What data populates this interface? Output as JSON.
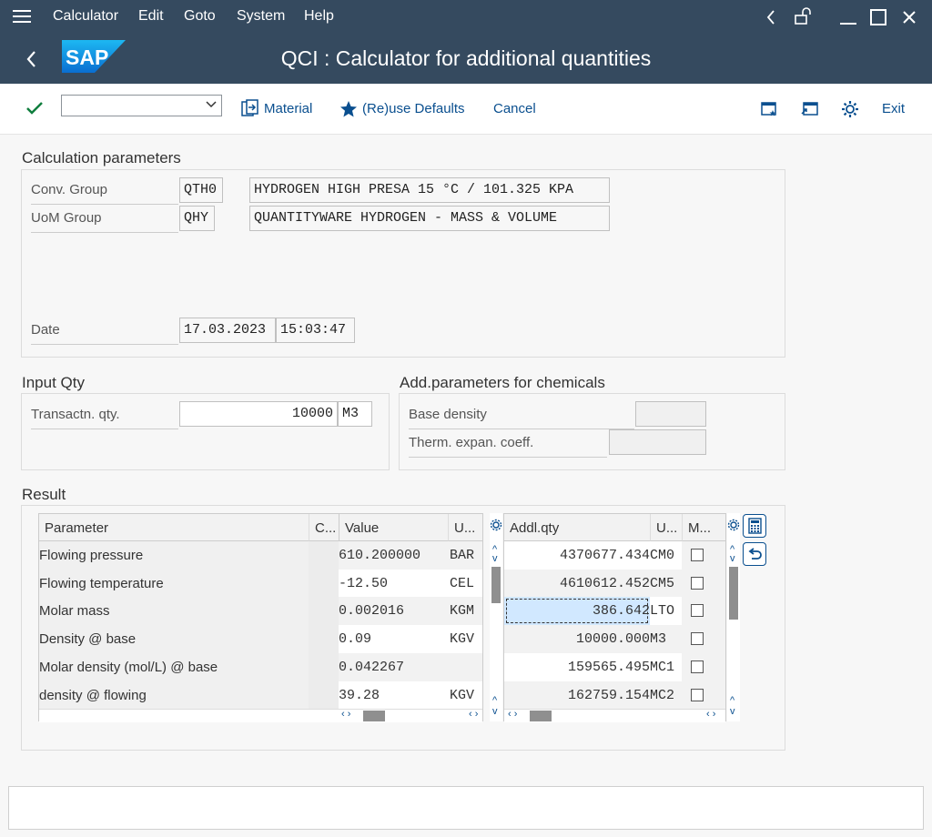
{
  "menu": {
    "items": [
      "Calculator",
      "Edit",
      "Goto",
      "System",
      "Help"
    ]
  },
  "window": {
    "title": "QCI : Calculator for additional quantities"
  },
  "toolbar": {
    "material": "Material",
    "reuse_defaults": "(Re)use Defaults",
    "cancel": "Cancel",
    "exit": "Exit"
  },
  "calc_params": {
    "title": "Calculation parameters",
    "conv_group_label": "Conv. Group",
    "conv_group_code": "QTH0",
    "conv_group_desc": "HYDROGEN HIGH PRESA 15 °C / 101.325 KPA",
    "uom_group_label": "UoM Group",
    "uom_group_code": "QHY",
    "uom_group_desc": "QUANTITYWARE HYDROGEN - MASS & VOLUME",
    "date_label": "Date",
    "date": "17.03.2023",
    "time": "15:03:47"
  },
  "input_qty": {
    "title": "Input Qty",
    "label": "Transactn. qty.",
    "value": "10000",
    "unit": "M3"
  },
  "chem_params": {
    "title": "Add.parameters for chemicals",
    "base_density_label": "Base density",
    "therm_label": "Therm. expan. coeff."
  },
  "result": {
    "title": "Result",
    "left_headers": {
      "parameter": "Parameter",
      "c": "C...",
      "value": "Value",
      "unit": "U..."
    },
    "right_headers": {
      "qty": "Addl.qty",
      "unit": "U...",
      "m": "M..."
    },
    "params": [
      {
        "name": "Flowing pressure",
        "value": "610.200000",
        "unit": "BAR"
      },
      {
        "name": "Flowing temperature",
        "value": "-12.50",
        "unit": "CEL"
      },
      {
        "name": "Molar mass",
        "value": "0.002016",
        "unit": "KGM"
      },
      {
        "name": "Density @ base",
        "value": "0.09",
        "unit": "KGV"
      },
      {
        "name": "Molar density (mol/L) @ base",
        "value": "0.042267",
        "unit": ""
      },
      {
        "name": "density @ flowing",
        "value": "39.28",
        "unit": "KGV"
      }
    ],
    "quantities": [
      {
        "qty": "4370677.434",
        "unit": "CM0"
      },
      {
        "qty": "4610612.452",
        "unit": "CM5"
      },
      {
        "qty": "386.642",
        "unit": "LTO"
      },
      {
        "qty": "10000.000",
        "unit": "M3"
      },
      {
        "qty": "159565.495",
        "unit": "MC1"
      },
      {
        "qty": "162759.154",
        "unit": "MC2"
      }
    ]
  }
}
